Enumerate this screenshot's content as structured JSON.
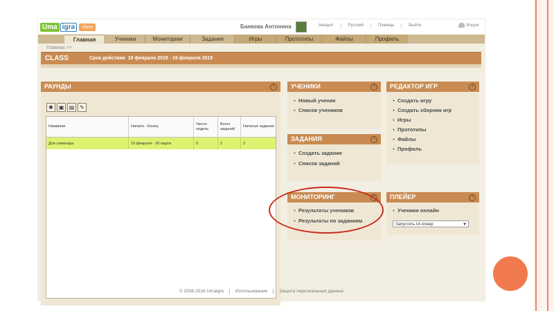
{
  "logo": {
    "part1": "Uma",
    "part2": "igra",
    "part3": "class"
  },
  "header": {
    "user_name": "Банкова Антонина",
    "links": [
      "Аккаунт",
      "Русский",
      "Помощь",
      "Выйти"
    ],
    "forum": "Форум"
  },
  "nav": {
    "main": [
      "Главная",
      "Ученики",
      "Мониторинг",
      "Задания"
    ],
    "secondary": [
      "Игры",
      "Прототипы",
      "Файлы",
      "Профиль"
    ]
  },
  "breadcrumb": "Главная >>",
  "class_bar": {
    "title": "CLASS",
    "deadline_label": "Срок действия",
    "deadline_value": "19 февраля 2018 - 19 февраля 2019"
  },
  "rounds": {
    "title": "РАУНДЫ",
    "help": "?",
    "tools": [
      "✱",
      "▣",
      "▤",
      "✎"
    ],
    "columns": [
      "Название",
      "Начало - Конец",
      "Число недель",
      "Всего заданий",
      "Начатые задания"
    ],
    "rows": [
      [
        "Для семинара",
        "19 февраля - 26 марта",
        "5",
        "2",
        "2"
      ]
    ]
  },
  "students": {
    "title": "УЧЕНИКИ",
    "help": "?",
    "links": [
      "Новый ученик",
      "Список учеников"
    ]
  },
  "tasks": {
    "title": "ЗАДАНИЯ",
    "help": "?",
    "links": [
      "Создать задание",
      "Список заданий"
    ]
  },
  "monitoring": {
    "title": "МОНИТОРИНГ",
    "help": "?",
    "links": [
      "Результаты учеников",
      "Результаты по заданиям"
    ]
  },
  "game_editor": {
    "title": "РЕДАКТОР ИГР",
    "help": "?",
    "links": [
      "Создать игру",
      "Создать сборник игр",
      "Игры",
      "Прототипы",
      "Файлы",
      "Профиль"
    ]
  },
  "player": {
    "title": "ПЛЕЙЕР",
    "help": "?",
    "links": [
      "Ученики онлайн"
    ],
    "select_value": "Запустить UI-плеер",
    "select_arrow": "▼"
  },
  "footer": {
    "items": [
      "© 2008-2016 Umaigra",
      "Использование",
      "Защита персональных данных"
    ]
  },
  "colors": {
    "panel_header": "#c98b52",
    "nav_bar": "#cdb991",
    "row_highlight": "#ddf271",
    "annotation": "#c72b1d",
    "slide_circle": "#f07a4e"
  }
}
